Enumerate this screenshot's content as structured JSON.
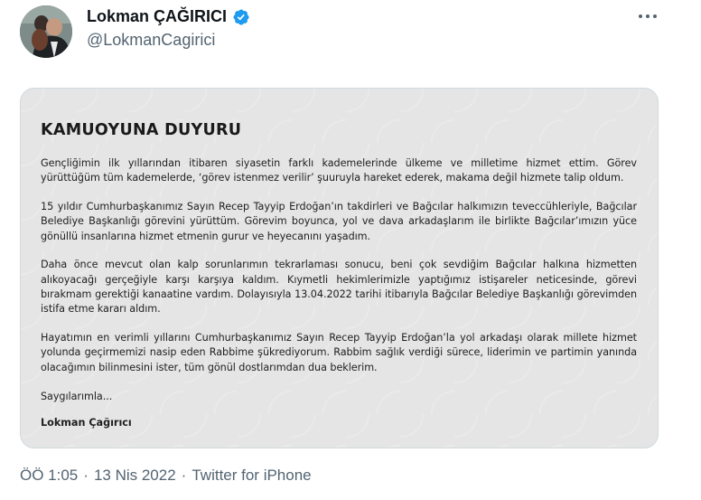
{
  "author": {
    "name": "Lokman ÇAĞIRICI",
    "handle": "@LokmanCagirici",
    "verified": true,
    "avatar_icon": "profile-photo",
    "verified_icon": "verified-badge-icon",
    "verified_color": "#1d9bf0"
  },
  "more_icon": "more-options-icon",
  "announcement": {
    "title": "KAMUOYUNA DUYURU",
    "paragraphs": [
      "Gençliğimin ilk yıllarından itibaren siyasetin farklı kademelerinde ülkeme ve milletime hizmet ettim. Görev yürüttüğüm tüm kademelerde, ‘görev istenmez verilir’ şuuruyla hareket ederek, makama değil hizmete talip oldum.",
      "15 yıldır Cumhurbaşkanımız Sayın Recep Tayyip Erdoğan’ın takdirleri ve Bağcılar halkımızın teveccühleriyle, Bağcılar Belediye Başkanlığı görevini yürüttüm. Görevim boyunca, yol ve dava arkadaşlarım ile birlikte Bağcılar’ımızın yüce gönüllü insanlarına hizmet etmenin gurur ve heyecanını yaşadım.",
      "Daha önce mevcut olan kalp sorunlarımın tekrarlaması sonucu, beni çok sevdiğim Bağcılar halkına hizmetten alıkoyacağı gerçeğiyle karşı karşıya kaldım. Kıymetli hekimlerimizle yaptığımız istişareler neticesinde, görevi bırakmam gerektiği kanaatine vardım. Dolayısıyla 13.04.2022 tarihi itibarıyla Bağcılar Belediye Başkanlığı görevimden istifa etme kararı aldım.",
      "Hayatımın en verimli yıllarını Cumhurbaşkanımız Sayın Recep Tayyip Erdoğan’la yol arkadaşı olarak millete hizmet yolunda geçirmemizi nasip eden Rabbime şükrediyorum. Rabbim sağlık verdiği sürece, liderimin ve partimin yanında olacağımın bilinmesini ister, tüm gönül dostlarımdan dua beklerim."
    ],
    "closing": "Saygılarımla...",
    "signature": "Lokman Çağırıcı",
    "background_color": "#e5e5e5"
  },
  "meta": {
    "time": "ÖÖ 1:05",
    "separator": "·",
    "date": "13 Nis 2022",
    "source": "Twitter for iPhone"
  }
}
